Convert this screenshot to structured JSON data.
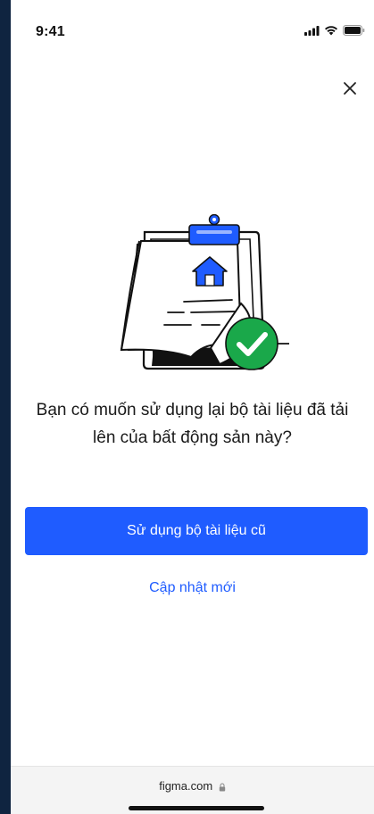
{
  "status_bar": {
    "time": "9:41",
    "icons": [
      "signal-icon",
      "wifi-icon",
      "battery-icon"
    ]
  },
  "dialog": {
    "close_icon": "close-icon",
    "illustration": "document-check-illustration",
    "question_line1": "Bạn có muốn sử dụng lại bộ tài liệu đã tải",
    "question_line2": "lên của bất động sản này?",
    "primary_button_label": "Sử dụng bộ tài liệu cũ",
    "secondary_link_label": "Cập nhật mới"
  },
  "browser": {
    "url": "figma.com",
    "lock_icon": "lock-icon"
  },
  "colors": {
    "accent": "#1f5cff",
    "success": "#1aa84a",
    "background": "#0f2440"
  }
}
